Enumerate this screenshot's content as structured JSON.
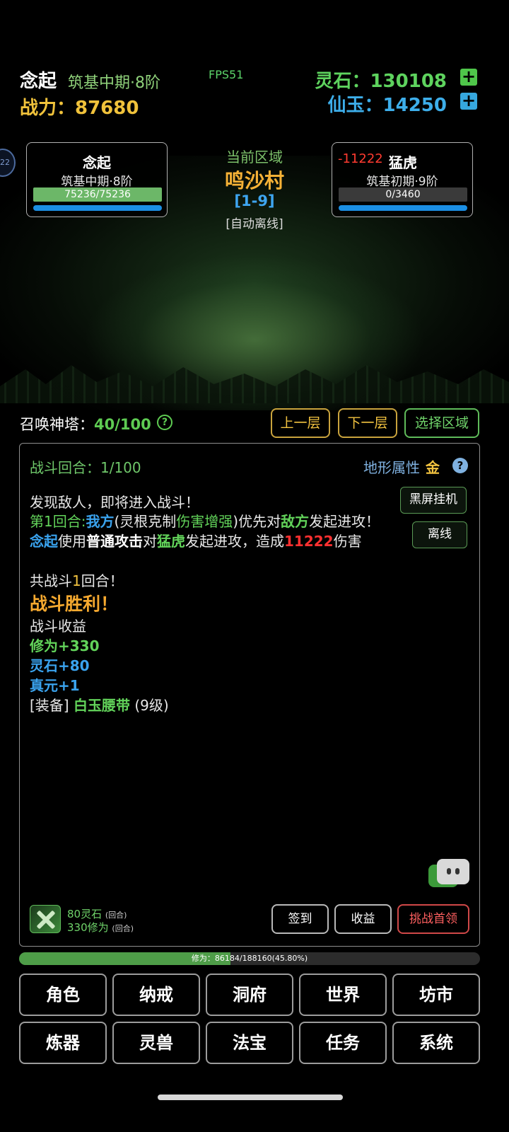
{
  "header": {
    "player_name": "念起",
    "realm": "筑基中期·8阶",
    "fps": "FPS51",
    "power_label": "战力：87680",
    "spirit_stone": "灵石：130108",
    "immortal_jade": "仙玉：14250",
    "plus_symbol": "+"
  },
  "side_badge": "22",
  "player_card": {
    "name": "念起",
    "realm": "筑基中期·8阶",
    "hp_text": "75236/75236",
    "hp_fraction": 1.0
  },
  "area": {
    "label": "当前区域",
    "name": "鸣沙村",
    "range": "[1-9]",
    "mode": "[自动离线]"
  },
  "enemy_card": {
    "damage": "-11222",
    "name": "猛虎",
    "realm": "筑基初期·9阶",
    "hp_text": "0/3460",
    "hp_fraction": 0
  },
  "tower": {
    "label": "召唤神塔：",
    "value": "40/100",
    "help": "?",
    "prev_floor": "上一层",
    "next_floor": "下一层",
    "select_area": "选择区域"
  },
  "battle": {
    "round_label": "战斗回合：1/100",
    "terrain_label": "地形属性",
    "terrain_value": "金",
    "help": "?",
    "black_screen": "黑屏挂机",
    "offline": "离线",
    "log": {
      "l1": "发现敌人，即将进入战斗！",
      "l2_a": "第1回合:",
      "l2_b": "我方",
      "l2_c": "(灵根克制",
      "l2_d": "伤害增强",
      "l2_e": ")优先对",
      "l2_f": "敌方",
      "l2_g": "发起进攻！",
      "l3_a": "念起",
      "l3_b": "使用",
      "l3_c": "普通攻击",
      "l3_d": "对",
      "l3_e": "猛虎",
      "l3_f": "发起进攻，造成",
      "l3_g": "11222",
      "l3_h": "伤害",
      "l4_a": "共战斗",
      "l4_b": "1",
      "l4_c": "回合！",
      "victory": "战斗胜利！",
      "rewards_label": "战斗收益",
      "cultivation": "修为+330",
      "stone": "灵石+80",
      "true_essence": "真元+1",
      "equip_a": "[装备]",
      "equip_b": "白玉腰带",
      "equip_c": "(9级)"
    }
  },
  "income": {
    "stone": "80灵石",
    "cultivation": "330修为",
    "unit": "(回合)"
  },
  "actions": {
    "checkin": "签到",
    "earnings": "收益",
    "challenge": "挑战首领"
  },
  "xp": {
    "text": "修为：86184/188160(45.80%)",
    "fraction": 0.458
  },
  "menu": {
    "row1": [
      "角色",
      "纳戒",
      "洞府",
      "世界",
      "坊市"
    ],
    "row2": [
      "炼器",
      "灵兽",
      "法宝",
      "任务",
      "系统"
    ]
  },
  "colors": {
    "accent_green": "#62d35a",
    "accent_blue": "#3aa3ee",
    "accent_gold": "#f3c340",
    "damage_red": "#ff3030"
  }
}
